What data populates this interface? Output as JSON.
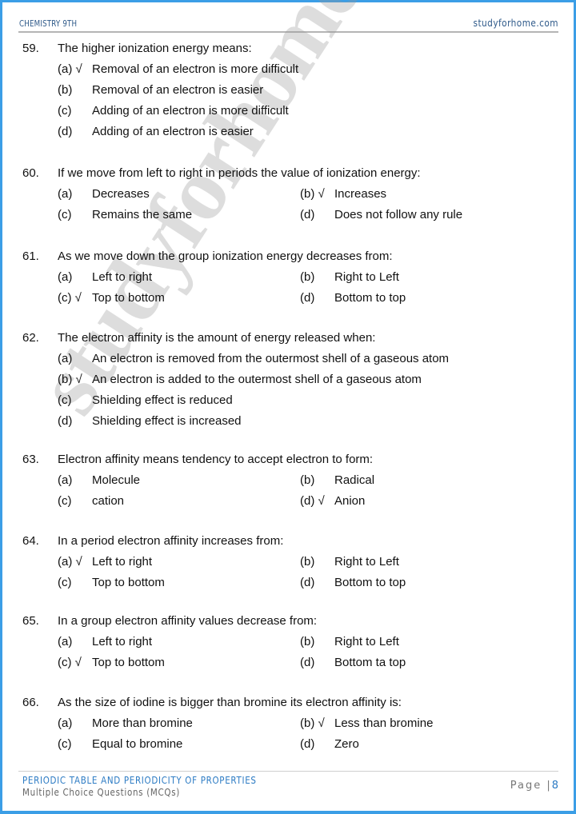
{
  "header": {
    "subject": "CHEMISTRY 9TH",
    "site": "studyforhome.com"
  },
  "watermark": "studyforhome.com",
  "questions": [
    {
      "number": "59.",
      "text": "The higher ionization energy means:",
      "layout": "single",
      "options": [
        {
          "label": "(a) √",
          "text": "Removal of an electron is more difficult"
        },
        {
          "label": "(b)",
          "text": "Removal of an electron is easier"
        },
        {
          "label": "(c)",
          "text": "Adding of an electron is more difficult"
        },
        {
          "label": "(d)",
          "text": "Adding of an electron is easier"
        }
      ]
    },
    {
      "number": "60.",
      "text": "If we move from left to right in periods the value of ionization energy:",
      "layout": "double",
      "options": [
        {
          "label": "(a)",
          "text": "Decreases"
        },
        {
          "label": "(b) √",
          "text": "Increases"
        },
        {
          "label": "(c)",
          "text": "Remains the same"
        },
        {
          "label": "(d)",
          "text": "Does not follow any rule"
        }
      ]
    },
    {
      "number": "61.",
      "text": "As we move down the group ionization energy decreases from:",
      "layout": "double",
      "options": [
        {
          "label": "(a)",
          "text": "Left to right"
        },
        {
          "label": "(b)",
          "text": "Right to Left"
        },
        {
          "label": "(c) √",
          "text": "Top to bottom"
        },
        {
          "label": "(d)",
          "text": "Bottom to top"
        }
      ]
    },
    {
      "number": "62.",
      "text": "The electron affinity is the amount of energy released when:",
      "layout": "single",
      "options": [
        {
          "label": "(a)",
          "text": "An electron is removed from the outermost shell of a gaseous atom"
        },
        {
          "label": "(b) √",
          "text": "An electron is added to the outermost shell of a gaseous atom"
        },
        {
          "label": "(c)",
          "text": "Shielding effect is reduced"
        },
        {
          "label": "(d)",
          "text": "Shielding effect is increased"
        }
      ]
    },
    {
      "number": "63.",
      "text": "Electron affinity means tendency to accept electron to form:",
      "layout": "double",
      "options": [
        {
          "label": "(a)",
          "text": "Molecule"
        },
        {
          "label": "(b)",
          "text": "Radical"
        },
        {
          "label": "(c)",
          "text": "cation"
        },
        {
          "label": "(d) √",
          "text": "Anion"
        }
      ]
    },
    {
      "number": "64.",
      "text": "In a period electron affinity increases from:",
      "layout": "double",
      "options": [
        {
          "label": "(a) √",
          "text": "Left to right"
        },
        {
          "label": "(b)",
          "text": "Right to Left"
        },
        {
          "label": "(c)",
          "text": "Top to bottom"
        },
        {
          "label": "(d)",
          "text": "Bottom to top"
        }
      ]
    },
    {
      "number": "65.",
      "text": "In a group electron affinity values decrease from:",
      "layout": "double",
      "options": [
        {
          "label": "(a)",
          "text": "Left to right"
        },
        {
          "label": "(b)",
          "text": "Right to Left"
        },
        {
          "label": "(c) √",
          "text": "Top to bottom"
        },
        {
          "label": "(d)",
          "text": "Bottom ta top"
        }
      ]
    },
    {
      "number": "66.",
      "text": "As the size of iodine is bigger than bromine its electron affinity is:",
      "layout": "double",
      "options": [
        {
          "label": "(a)",
          "text": "More than bromine"
        },
        {
          "label": "(b) √",
          "text": "Less than bromine"
        },
        {
          "label": "(c)",
          "text": "Equal to bromine"
        },
        {
          "label": "(d)",
          "text": "Zero"
        }
      ]
    }
  ],
  "footer": {
    "chapter": "PERIODIC TABLE AND PERIODICITY OF PROPERTIES",
    "section": "Multiple Choice Questions (MCQs)",
    "page_label": "Page |",
    "page_number": "8"
  }
}
